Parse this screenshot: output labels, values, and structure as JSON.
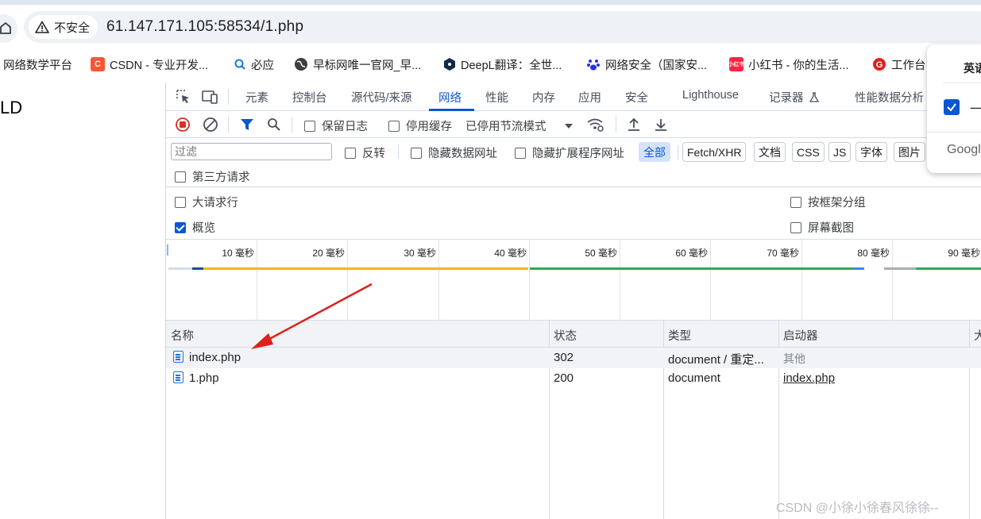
{
  "browser": {
    "security_label": "不安全",
    "url": "61.147.171.105:58534/1.php"
  },
  "bookmarks": [
    {
      "label": "网络数学平台",
      "icon": "none"
    },
    {
      "label": "CSDN - 专业开发...",
      "icon": "csdn-icon"
    },
    {
      "label": "必应",
      "icon": "bing-search-icon"
    },
    {
      "label": "早标网唯一官网_早...",
      "icon": "globe-icon"
    },
    {
      "label": "DeepL翻译：全世...",
      "icon": "deepl-icon"
    },
    {
      "label": "网络安全（国家安...",
      "icon": "baidu-paw-icon"
    },
    {
      "label": "小红书 - 你的生活...",
      "icon": "xiaohongshu-icon"
    },
    {
      "label": "工作台",
      "icon": "g-icon"
    }
  ],
  "page": {
    "text": "LD"
  },
  "devtools": {
    "tabs": [
      "元素",
      "控制台",
      "源代码/来源",
      "网络",
      "性能",
      "内存",
      "应用",
      "安全",
      "Lighthouse",
      "记录器",
      "性能数据分析"
    ],
    "active_tab": "网络",
    "toolbar": {
      "preserve_log": "保留日志",
      "disable_cache": "停用缓存",
      "throttling": "已停用节流模式"
    },
    "filter": {
      "placeholder": "过滤",
      "invert": "反转",
      "hide_data_urls": "隐藏数据网址",
      "hide_extension_urls": "隐藏扩展程序网址",
      "types": [
        "全部",
        "Fetch/XHR",
        "文档",
        "CSS",
        "JS",
        "字体",
        "图片"
      ],
      "active_type": "全部",
      "third_party": "第三方请求"
    },
    "options": {
      "big_rows": {
        "label": "大请求行",
        "checked": false
      },
      "group_by_frame": {
        "label": "按框架分组",
        "checked": false
      },
      "overview": {
        "label": "概览",
        "checked": true
      },
      "screenshots": {
        "label": "屏幕截图",
        "checked": false
      }
    },
    "timeline_ticks": [
      "10 毫秒",
      "20 毫秒",
      "30 毫秒",
      "40 毫秒",
      "50 毫秒",
      "60 毫秒",
      "70 毫秒",
      "80 毫秒",
      "90 毫秒"
    ],
    "table": {
      "headers": [
        "名称",
        "状态",
        "类型",
        "启动器",
        "大"
      ],
      "rows": [
        {
          "name": "index.php",
          "status": "302",
          "type": "document / 重定...",
          "initiator": "其他"
        },
        {
          "name": "1.php",
          "status": "200",
          "type": "document",
          "initiator": "index.php"
        }
      ]
    }
  },
  "popup": {
    "title": "英语",
    "item": "一",
    "footer": "Googl"
  },
  "watermark": "CSDN @小徐小徐春风徐徐--",
  "colors": {
    "accent": "#0b57d0",
    "record_red": "#d93025",
    "arrow_red": "#e0201b",
    "timeline_orange": "#f0b323",
    "timeline_green": "#34a853"
  }
}
